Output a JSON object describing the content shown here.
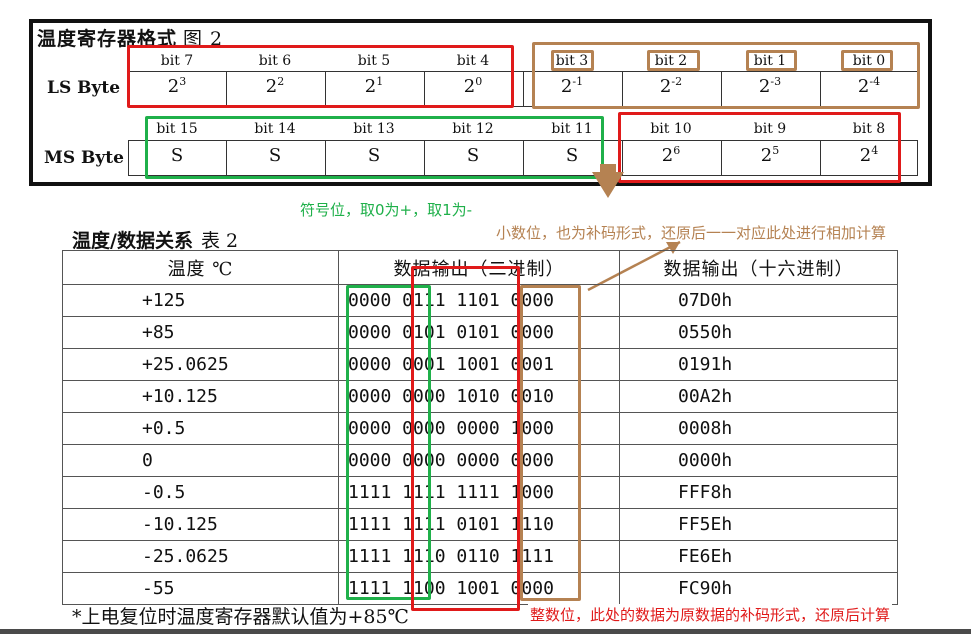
{
  "figure2": {
    "title": "温度寄存器格式",
    "fig_no": "图 2",
    "ls_byte": {
      "label": "LS Byte",
      "bits": [
        "bit 7",
        "bit 6",
        "bit 5",
        "bit 4",
        "bit 3",
        "bit 2",
        "bit 1",
        "bit 0"
      ],
      "cells": [
        {
          "base": "2",
          "exp": "3"
        },
        {
          "base": "2",
          "exp": "2"
        },
        {
          "base": "2",
          "exp": "1"
        },
        {
          "base": "2",
          "exp": "0"
        },
        {
          "base": "2",
          "exp": "-1"
        },
        {
          "base": "2",
          "exp": "-2"
        },
        {
          "base": "2",
          "exp": "-3"
        },
        {
          "base": "2",
          "exp": "-4"
        }
      ]
    },
    "ms_byte": {
      "label": "MS Byte",
      "bits": [
        "bit 15",
        "bit 14",
        "bit 13",
        "bit 12",
        "bit 11",
        "bit 10",
        "bit 9",
        "bit 8"
      ],
      "cells": [
        {
          "base": "S",
          "exp": ""
        },
        {
          "base": "S",
          "exp": ""
        },
        {
          "base": "S",
          "exp": ""
        },
        {
          "base": "S",
          "exp": ""
        },
        {
          "base": "S",
          "exp": ""
        },
        {
          "base": "2",
          "exp": "6"
        },
        {
          "base": "2",
          "exp": "5"
        },
        {
          "base": "2",
          "exp": "4"
        }
      ]
    }
  },
  "annotations": {
    "sign_bit": "符号位，取0为+，取1为-",
    "fraction_bits": "小数位，也为补码形式，还原后一一对应此处进行相加计算",
    "integer_bits": "整数位，此处的数据为原数据的补码形式，还原后计算",
    "colors": {
      "red": "#e01a1a",
      "green": "#1fb04a",
      "brown": "#b58252"
    }
  },
  "table2": {
    "title": "温度/数据关系",
    "table_no": "表 2",
    "headers": [
      "温度 ℃",
      "数据输出（二进制）",
      "数据输出（十六进制）"
    ],
    "rows": [
      {
        "temp": "+125",
        "bin": "0000 0111 1101 0000",
        "hex": "07D0h"
      },
      {
        "temp": "+85",
        "bin": "0000 0101 0101 0000",
        "hex": "0550h"
      },
      {
        "temp": "+25.0625",
        "bin": "0000 0001 1001 0001",
        "hex": "0191h"
      },
      {
        "temp": "+10.125",
        "bin": "0000 0000 1010 0010",
        "hex": "00A2h"
      },
      {
        "temp": "+0.5",
        "bin": "0000 0000 0000 1000",
        "hex": "0008h"
      },
      {
        "temp": "0",
        "bin": "0000 0000 0000 0000",
        "hex": "0000h"
      },
      {
        "temp": "-0.5",
        "bin": "1111 1111 1111 1000",
        "hex": "FFF8h"
      },
      {
        "temp": "-10.125",
        "bin": "1111 1111 0101 1110",
        "hex": "FF5Eh"
      },
      {
        "temp": "-25.0625",
        "bin": "1111 1110 0110 1111",
        "hex": "FE6Eh"
      },
      {
        "temp": "-55",
        "bin": "1111 1100 1001 0000",
        "hex": "FC90h"
      }
    ],
    "footnote": "*上电复位时温度寄存器默认值为+85℃"
  }
}
